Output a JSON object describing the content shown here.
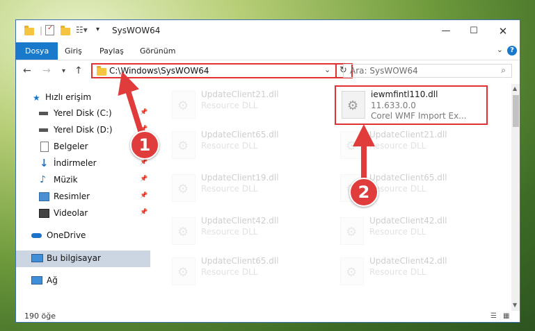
{
  "window": {
    "title": "SysWOW64",
    "minimize_icon": "minimize-icon",
    "maximize_icon": "maximize-icon",
    "close_icon": "close-icon"
  },
  "ribbon": {
    "tabs": [
      "Dosya",
      "Giriş",
      "Paylaş",
      "Görünüm"
    ],
    "help": "?"
  },
  "address": {
    "path": "C:\\Windows\\SysWOW64",
    "search_placeholder": "Ara: SysWOW64"
  },
  "nav": {
    "items": [
      {
        "label": "Hızlı erişim",
        "icon": "star-icon"
      },
      {
        "label": "Yerel Disk (C:)",
        "icon": "drive-icon",
        "pinned": true
      },
      {
        "label": "Yerel Disk (D:)",
        "icon": "drive-icon",
        "pinned": true
      },
      {
        "label": "Belgeler",
        "icon": "documents-icon",
        "pinned": true
      },
      {
        "label": "İndirmeler",
        "icon": "download-icon",
        "pinned": true
      },
      {
        "label": "Müzik",
        "icon": "music-icon",
        "pinned": true
      },
      {
        "label": "Resimler",
        "icon": "pictures-icon",
        "pinned": true
      },
      {
        "label": "Videolar",
        "icon": "videos-icon",
        "pinned": true
      },
      {
        "label": "OneDrive",
        "icon": "cloud-icon"
      },
      {
        "label": "Bu bilgisayar",
        "icon": "computer-icon",
        "selected": true
      },
      {
        "label": "Ağ",
        "icon": "network-icon"
      }
    ]
  },
  "files": {
    "left": [
      {
        "name": "UpdateClient21.dll",
        "type": "Resource DLL"
      },
      {
        "name": "UpdateClient65.dll",
        "type": "Resource DLL"
      },
      {
        "name": "UpdateClient19.dll",
        "type": "Resource DLL"
      },
      {
        "name": "UpdateClient42.dll",
        "type": "Resource DLL"
      },
      {
        "name": "UpdateClient65.dll",
        "type": "Resource DLL"
      }
    ],
    "right": [
      {
        "name": "iewmfintl110.dll",
        "version": "11.633.0.0",
        "desc": "Corel WMF Import Ex...",
        "highlighted": true
      },
      {
        "name": "UpdateClient21.dll",
        "type": "Resource DLL"
      },
      {
        "name": "UpdateClient65.dll",
        "type": "Resource DLL"
      },
      {
        "name": "UpdateClient42.dll",
        "type": "Resource DLL"
      },
      {
        "name": "UpdateClient42.dll",
        "type": "Resource DLL"
      }
    ]
  },
  "status": {
    "count": "190 öğe"
  },
  "annotations": {
    "step1": "1",
    "step2": "2",
    "color": "#e03c3c"
  }
}
